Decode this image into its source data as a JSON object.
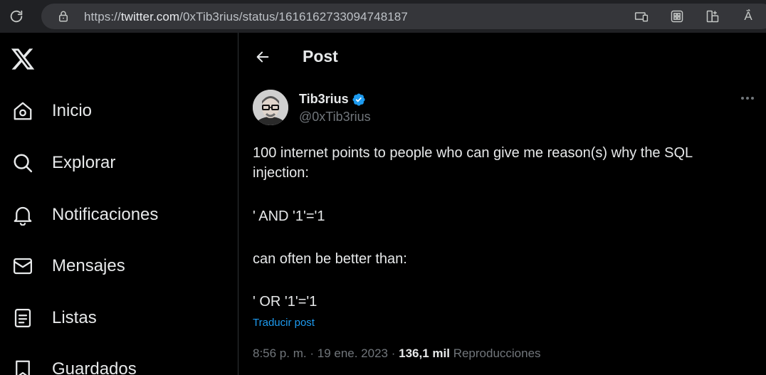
{
  "browser": {
    "url_prefix": "https://",
    "url_domain": "twitter.com",
    "url_path": "/0xTib3rius/status/1616162733094748187",
    "toolbar_icons": [
      "device-icon",
      "extensions-grid-icon",
      "add-tab-icon",
      "read-aloud-icon"
    ],
    "read_aloud_glyph": "Ä́"
  },
  "sidebar": {
    "items": [
      {
        "label": "Inicio",
        "icon": "home-icon"
      },
      {
        "label": "Explorar",
        "icon": "search-icon"
      },
      {
        "label": "Notificaciones",
        "icon": "bell-icon"
      },
      {
        "label": "Mensajes",
        "icon": "mail-icon"
      },
      {
        "label": "Listas",
        "icon": "list-icon"
      },
      {
        "label": "Guardados",
        "icon": "bookmark-icon"
      }
    ]
  },
  "header": {
    "title": "Post"
  },
  "tweet": {
    "author_name": "Tib3rius",
    "handle": "@0xTib3rius",
    "verified": true,
    "text_line1": "100 internet points to people who can give me reason(s) why the SQL injection:",
    "text_line2": "' AND '1'='1",
    "text_line3": "can often be better than:",
    "text_line4": "' OR '1'='1",
    "translate_label": "Traducir post",
    "time": "8:56 p. m.",
    "date": "19 ene. 2023",
    "views_count": "136,1 mil",
    "views_label": "Reproducciones"
  },
  "colors": {
    "background": "#000000",
    "text_primary": "#e7e9ea",
    "text_secondary": "#71767b",
    "accent": "#1d9bf0",
    "divider": "#2f3336"
  }
}
